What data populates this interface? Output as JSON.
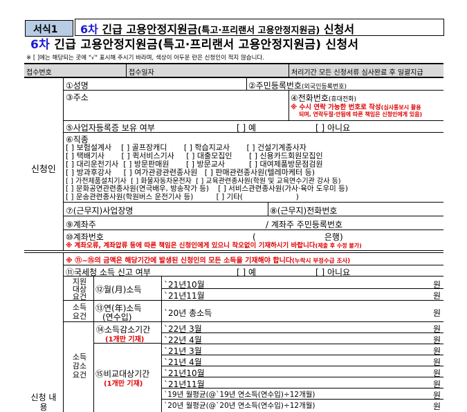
{
  "header": {
    "form_no": "서식1",
    "title_top_num": "6차",
    "title_top_main": " 긴급 고용안정지원금",
    "title_top_paren": "(특고·프리랜서 고용안정지원금)",
    "title_top_end": " 신청서",
    "title_big_num": "6차",
    "title_big_main": " 긴급 고용안정지원금(특고·프리랜서 고용안정지원금) 신청서",
    "instruction": "※ [ ]에는 해당되는 곳에 \"√\" 표시해 주시기 바라며, 색상이 어두운 란은 신청인이 적지 않습니다."
  },
  "receipt": {
    "receipt_no": "접수번호",
    "receipt_date": "접수일자",
    "processing": "처리기간 모든 신청서류 심사완료 후 일괄지급"
  },
  "applicant": {
    "section_label": "신청인",
    "name": "①성명",
    "rrn": "②주민등록번호",
    "rrn_note": "(외국인등록번호)",
    "address": "③주소",
    "phone": "④전화번호",
    "phone_note": "(휴대전화)",
    "phone_warn1": "※ 수시 연락 가능한 번호로 작성",
    "phone_warn1b": "(심사통보시 활용",
    "phone_warn2": "되며, 연락두절·안됨에 따른 책임은 신청인에게 있음)",
    "biz_reg": "⑤사업자등록증 보유 여부",
    "yes": "[ ] 예",
    "no": "[ ] 아니요",
    "occupation": "⑥직종",
    "occ_rows": [
      "[ ] 보험설계사    [ ] 골프장캐디       [ ] 학습지교사       [ ] 건설기계종사자",
      "[ ] 택배기사       [ ] 퀵서비스기사     [ ] 대출모집인       [ ] 신용카드회원모집인",
      "[ ] 대리운전기사  [ ] 방문판매원       [ ] 방문교사          [ ] 대여제품방문점검원",
      "[ ] 방과후강사     [ ] 여가관광관련종사원   [ ] 판매관련종사원(텔레마케터 등)",
      "[ ] 가전제품설치기사  [ ] 화물자동차운전자  [ ] 교육관련종사원(학원 및 교육연수기관 강사 등)",
      "[ ] 문화공연관련종사원(연극배우, 방송작가 등)    [ ] 서비스관련종사원(가사·육아 도우미 등)",
      "[ ] 운송관련종사원(학원버스 운전기사 등)          [ ] 기타(                       )"
    ],
    "workplace": "⑦(근무지)사업장명",
    "work_phone": "⑧(근무지)전화번호",
    "holder": "⑨계좌주",
    "holder_rrn": "/ 계좌주 주민등록번호",
    "account": "⑩계좌번호",
    "account_fill": "(                          은행)",
    "account_warn": "※ 계좌오류, 계좌압류 등에 따른 책임은 신청인에게 있으니 착오없이 기재하시기 바랍니다",
    "account_warn_small": "(제출 후 수정 불가)"
  },
  "income": {
    "section_label": "신청 내용",
    "note": "※ ⑪~⑮의 금액은 해당기간에 발생된 신청인의 모든 소득을 기재해야 합니다",
    "note_small": "(누락시 부정수급 조사)",
    "tax": "⑪국세청 소득 신고 여부",
    "req1_label": "지원 대상 요건",
    "monthly": "⑫월(月)소득",
    "req2_label": "소득 요건",
    "annual": "⑬연(年)소득",
    "annual2": "(연수입)",
    "req3_label": "소득 감소 요건",
    "decrease": "⑭소득감소기간",
    "decrease_note": "(1개만 기재)",
    "compare": "⑮비교대상기간",
    "compare_note": "(1개만 기재)",
    "won": "원",
    "rows": [
      "`21년10월",
      "`21년11월",
      "`20년 총소득",
      "`22년 3월",
      "`22년 4월",
      "`21년 3월",
      "`21년 4월",
      "`21년10월",
      "`21년11월",
      "`19년 월평균(@`19년 연소득(연수입)÷12개월)",
      "`20년 월평균(@`20년 연소득(연수입)÷12개월)"
    ]
  }
}
